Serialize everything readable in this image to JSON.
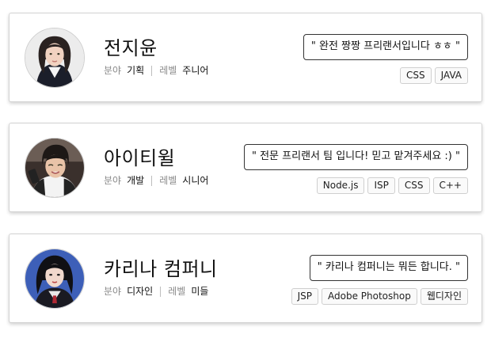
{
  "labels": {
    "field": "분야",
    "level": "레벨"
  },
  "profiles": [
    {
      "name": "전지윤",
      "field": "기획",
      "level": "주니어",
      "intro": "\" 완전 짱짱 프리랜서입니다 ㅎㅎ \"",
      "tags": [
        "CSS",
        "JAVA"
      ],
      "avatar": "woman-portrait-photo"
    },
    {
      "name": "아이티윌",
      "field": "개발",
      "level": "시니어",
      "intro": "\" 전문 프리랜서 팀 입니다! 믿고 맡겨주세요 :) \"",
      "tags": [
        "Node.js",
        "ISP",
        "CSS",
        "C++"
      ],
      "avatar": "man-portrait-photo"
    },
    {
      "name": "카리나 컴퍼니",
      "field": "디자인",
      "level": "미들",
      "intro": "\" 카리나 컴퍼니는 뭐든 합니다. \"",
      "tags": [
        "JSP",
        "Adobe Photoshop",
        "웹디자인"
      ],
      "avatar": "woman-portrait-photo"
    }
  ]
}
